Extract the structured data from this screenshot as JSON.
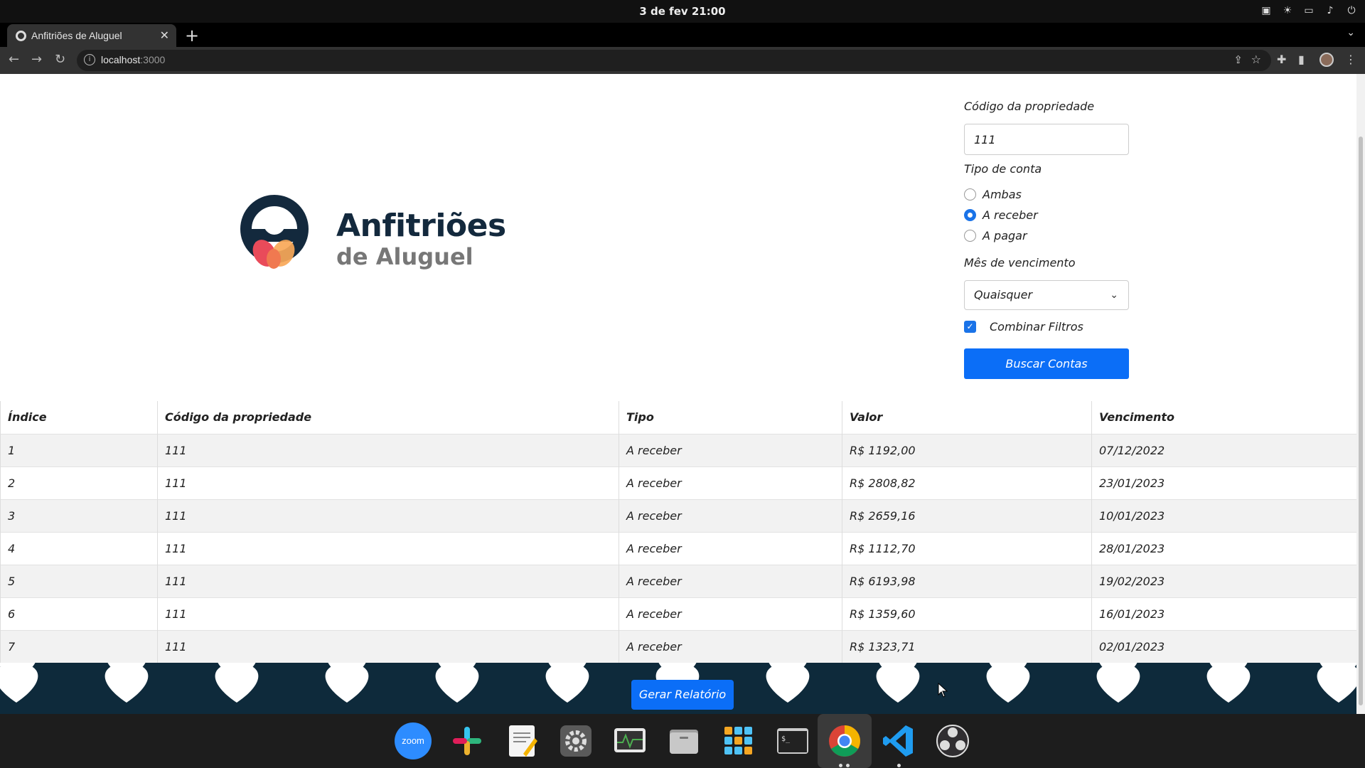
{
  "system": {
    "clock": "3 de fev  21:00"
  },
  "browser": {
    "tab_title": "Anfitriões de Aluguel",
    "url_host": "localhost",
    "url_port": ":3000"
  },
  "logo": {
    "line1": "Anfitriões",
    "line2": "de Aluguel"
  },
  "form": {
    "property_code_label": "Código da propriedade",
    "property_code_value": "111",
    "account_type_label": "Tipo de conta",
    "radio_options": [
      "Ambas",
      "A receber",
      "A pagar"
    ],
    "radio_selected": "A receber",
    "due_month_label": "Mês de vencimento",
    "due_month_value": "Quaisquer",
    "combine_filters_label": "Combinar Filtros",
    "combine_filters_checked": true,
    "search_button": "Buscar Contas"
  },
  "table": {
    "headers": [
      "Índice",
      "Código da propriedade",
      "Tipo",
      "Valor",
      "Vencimento"
    ],
    "rows": [
      [
        "1",
        "111",
        "A receber",
        "R$ 1192,00",
        "07/12/2022"
      ],
      [
        "2",
        "111",
        "A receber",
        "R$ 2808,82",
        "23/01/2023"
      ],
      [
        "3",
        "111",
        "A receber",
        "R$ 2659,16",
        "10/01/2023"
      ],
      [
        "4",
        "111",
        "A receber",
        "R$ 1112,70",
        "28/01/2023"
      ],
      [
        "5",
        "111",
        "A receber",
        "R$ 6193,98",
        "19/02/2023"
      ],
      [
        "6",
        "111",
        "A receber",
        "R$ 1359,60",
        "16/01/2023"
      ],
      [
        "7",
        "111",
        "A receber",
        "R$ 1323,71",
        "02/01/2023"
      ]
    ]
  },
  "footer": {
    "report_button": "Gerar Relatório"
  },
  "dock": {
    "apps": [
      "zoom-app-icon",
      "slack-app-icon",
      "text-editor-app-icon",
      "settings-app-icon",
      "system-monitor-app-icon",
      "files-app-icon",
      "app-grid-icon",
      "terminal-app-icon",
      "chrome-app-icon",
      "vscode-app-icon",
      "obs-app-icon"
    ],
    "zoom_label": "zoom"
  },
  "colors": {
    "primary": "#0b6ef7",
    "brand_dark": "#13293d",
    "footer_bg": "#0e2a3b"
  }
}
